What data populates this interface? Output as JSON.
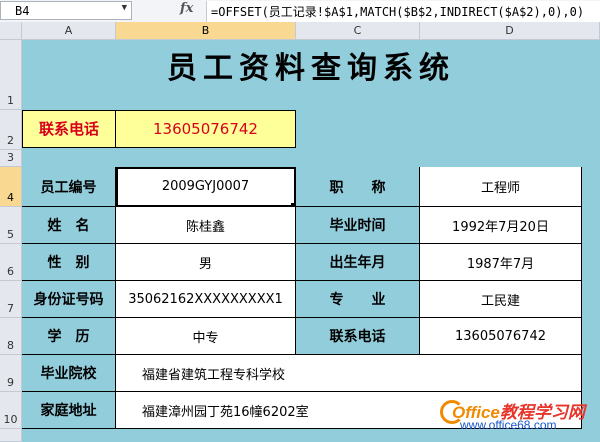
{
  "formula_bar": {
    "cell_ref": "B4",
    "fx_label": "fx",
    "formula": "=OFFSET(员工记录!$A$1,MATCH($B$2,INDIRECT($A$2),0),0)"
  },
  "columns": [
    "A",
    "B",
    "C",
    "D"
  ],
  "rows": [
    "1",
    "2",
    "3",
    "4",
    "5",
    "6",
    "7",
    "8",
    "9",
    "10"
  ],
  "title": "员工资料查询系统",
  "lookup": {
    "label": "联系电话",
    "value": "13605076742"
  },
  "record": {
    "emp_no_label": "员工编号",
    "emp_no": "2009GYJ0007",
    "position_label": "职　　称",
    "position": "工程师",
    "name_label": "姓　名",
    "name": "陈桂鑫",
    "grad_time_label": "毕业时间",
    "grad_time": "1992年7月20日",
    "gender_label": "性　别",
    "gender": "男",
    "birth_label": "出生年月",
    "birth": "1987年7月",
    "id_label": "身份证号码",
    "id": "35062162XXXXXXXXX1",
    "major_label": "专　　业",
    "major": "工民建",
    "education_label": "学　历",
    "education": "中专",
    "phone_label": "联系电话",
    "phone": "13605076742",
    "school_label": "毕业院校",
    "school": "福建省建筑工程专科学校",
    "address_label": "家庭地址",
    "address": "福建漳州园丁苑16幢6202室"
  },
  "watermark": {
    "line1_brand": "Office",
    "line1_rest": "教程学习网",
    "line2": "www.office68.com"
  },
  "colors": {
    "sheet_bg": "#92cddc",
    "highlight": "#ffff99",
    "accent_red": "#d9001b",
    "header_sel": "#f9d891"
  }
}
